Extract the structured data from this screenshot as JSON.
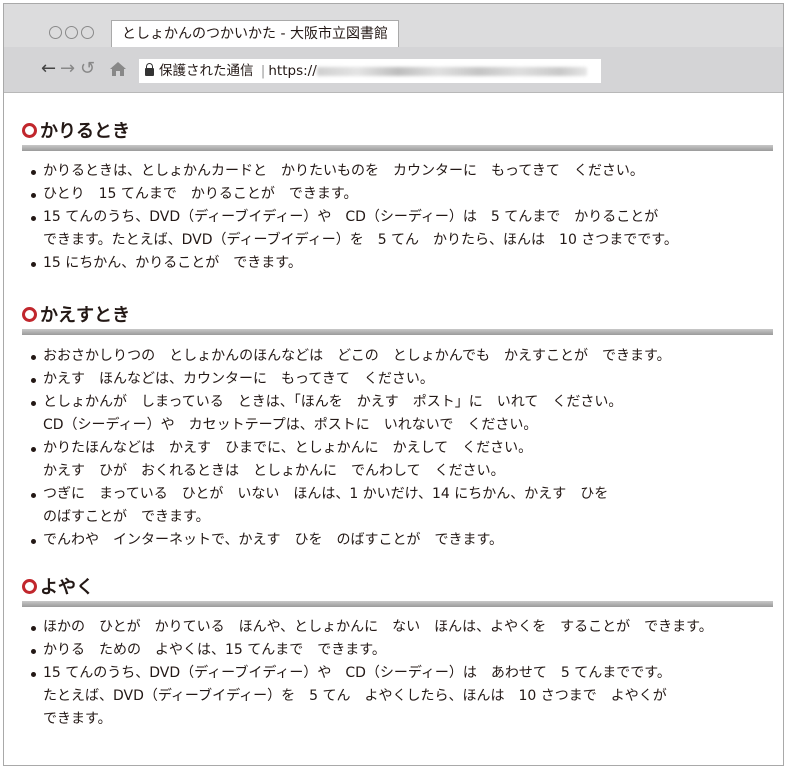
{
  "browser": {
    "tab_title": "としょかんのつかいかた - 大阪市立図書館",
    "nav_back": "←",
    "nav_forward": "→",
    "nav_reload": "↺",
    "address_security": "保護された通信",
    "address_separator": "|",
    "address_scheme": "https://"
  },
  "sections": [
    {
      "heading": "かりるとき",
      "items": [
        [
          "かりるときは、としょかんカードと　かりたいものを　カウンターに　もってきて　ください。"
        ],
        [
          "ひとり　15 てんまで　かりることが　できます。"
        ],
        [
          "15 てんのうち、DVD（ディーブイディー）や　CD（シーディー）は　5 てんまで　かりることが",
          "できます。たとえば、DVD（ディーブイディー）を　5 てん　かりたら、ほんは　10 さつまでです。"
        ],
        [
          "15 にちかん、かりることが　できます。"
        ]
      ]
    },
    {
      "heading": "かえすとき",
      "items": [
        [
          "おおさかしりつの　としょかんのほんなどは　どこの　としょかんでも　かえすことが　できます。"
        ],
        [
          "かえす　ほんなどは、カウンターに　もってきて　ください。"
        ],
        [
          "としょかんが　しまっている　ときは、「ほんを　かえす　ポスト」に　いれて　ください。",
          "CD（シーディー）や　カセットテープは、ポストに　いれないで　ください。"
        ],
        [
          "かりたほんなどは　かえす　ひまでに、としょかんに　かえして　ください。",
          "かえす　ひが　おくれるときは　としょかんに　でんわして　ください。"
        ],
        [
          "つぎに　まっている　ひとが　いない　ほんは、1 かいだけ、14 にちかん、かえす　ひを",
          "のばすことが　できます。"
        ],
        [
          "でんわや　インターネットで、かえす　ひを　のばすことが　できます。"
        ]
      ]
    },
    {
      "heading": "よやく",
      "items": [
        [
          "ほかの　ひとが　かりている　ほんや、としょかんに　ない　ほんは、よやくを　することが　できます。"
        ],
        [
          "かりる　ための　よやくは、15 てんまで　できます。"
        ],
        [
          "15 てんのうち、DVD（ディーブイディー）や　CD（シーディー）は　あわせて　5 てんまでです。",
          "たとえば、DVD（ディーブイディー）を　5 てん　よやくしたら、ほんは　10 さつまで　よやくが",
          "できます。"
        ]
      ]
    }
  ]
}
